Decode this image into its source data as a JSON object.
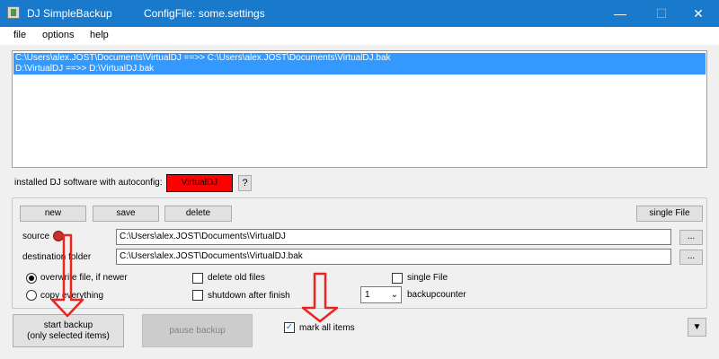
{
  "window": {
    "title": "DJ SimpleBackup",
    "config_file": "ConfigFile: some.settings",
    "controls": {
      "minimize": "—",
      "maximize": "☐",
      "close": "✕"
    }
  },
  "menu": [
    "file",
    "options",
    "help"
  ],
  "backup_list": [
    "C:\\Users\\alex.JOST\\Documents\\VirtualDJ  ==>>  C:\\Users\\alex.JOST\\Documents\\VirtualDJ.bak",
    "D:\\VirtualDJ  ==>>  D:\\VirtualDJ.bak"
  ],
  "autoconfig": {
    "label": "installed DJ software with autoconfig:",
    "software_button": "VirtualDJ",
    "help_button": "?"
  },
  "toolbar": {
    "new_label": "new",
    "save_label": "save",
    "delete_label": "delete",
    "single_file_label": "single File"
  },
  "source": {
    "label": "source",
    "value": "C:\\Users\\alex.JOST\\Documents\\VirtualDJ",
    "browse_label": "..."
  },
  "destination": {
    "label": "destination folder",
    "value": "C:\\Users\\alex.JOST\\Documents\\VirtualDJ.bak",
    "browse_label": "..."
  },
  "options": {
    "overwrite_label": "overwrite file, if newer",
    "copy_label": "copy everything",
    "overwrite_checked": true,
    "copy_checked": false,
    "delete_old_label": "delete old files",
    "delete_old_checked": false,
    "shutdown_label": "shutdown after finish",
    "shutdown_checked": false,
    "single_file_label": "single File",
    "single_file_checked": false,
    "backupcounter_value": "1",
    "backupcounter_label": "backupcounter"
  },
  "actions": {
    "start_line1": "start backup",
    "start_line2": "(only selected items)",
    "pause_label": "pause backup",
    "mark_all_label": "mark all items",
    "mark_all_checked": true,
    "dropdown_glyph": "▼"
  },
  "colors": {
    "titlebar": "#1979ca",
    "selection": "#3399ff",
    "autoconfig_button": "#ff0000",
    "annotation": "#e8251e"
  }
}
